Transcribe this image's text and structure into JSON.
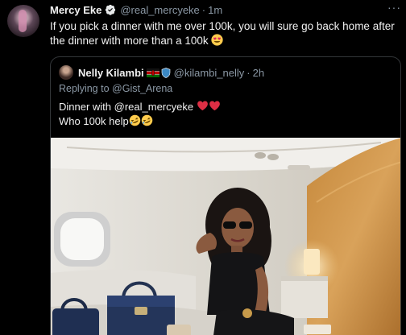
{
  "tweet": {
    "name": "Mercy Eke",
    "handle": "@real_mercyeke",
    "separator": "·",
    "time": "1m",
    "more": "···",
    "text": "If you pick a dinner with me over 100k, you will sure go back home after the dinner with more than a 100k",
    "emoji_icon": "heart-eyes-emoji-icon"
  },
  "quote": {
    "name": "Nelly Kilambi",
    "handle": "@kilambi_nelly",
    "separator": "·",
    "time": "2h",
    "replying_prefix": "Replying to",
    "replying_to": "@Gist_Arena",
    "line1": "Dinner with @real_mercyeke",
    "line2": "Who 100k help",
    "emoji_icons": [
      "red-heart-icon",
      "red-heart-icon",
      "rofl-emoji-icon",
      "rofl-emoji-icon"
    ]
  },
  "colors": {
    "background": "#000000",
    "text": "#e7e9ea",
    "muted": "#8b98a5",
    "verified": "#1d9bf0",
    "border": "#333639",
    "heart": "#e0245e"
  }
}
